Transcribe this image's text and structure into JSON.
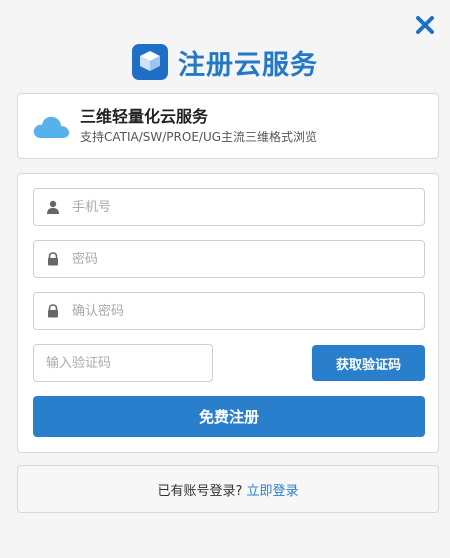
{
  "window": {
    "title": "注册云服务",
    "close_icon": "close-icon",
    "accent_color": "#2479c6"
  },
  "banner": {
    "icon": "cloud-icon",
    "title": "三维轻量化云服务",
    "subtitle": "支持CATIA/SW/PROE/UG主流三维格式浏览"
  },
  "form": {
    "phone": {
      "placeholder": "手机号",
      "value": "",
      "icon": "user-icon"
    },
    "password": {
      "placeholder": "密码",
      "value": "",
      "icon": "lock-icon"
    },
    "confirm_password": {
      "placeholder": "确认密码",
      "value": "",
      "icon": "lock-icon"
    },
    "verify_code": {
      "placeholder": "输入验证码",
      "value": ""
    },
    "get_code_label": "获取验证码",
    "submit_label": "免费注册",
    "button_color": "#2a7fcc"
  },
  "footer": {
    "prompt": "已有账号登录?",
    "login_link": "立即登录"
  }
}
